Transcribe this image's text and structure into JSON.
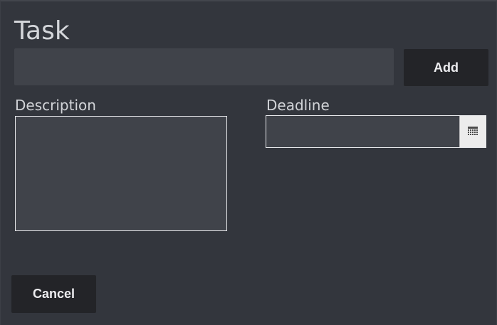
{
  "form": {
    "title": "Task",
    "task_input": {
      "value": "",
      "placeholder": ""
    },
    "add_label": "Add",
    "description_label": "Description",
    "description_value": "",
    "deadline_label": "Deadline",
    "deadline_value": "",
    "calendar_icon": "calendar-icon",
    "cancel_label": "Cancel"
  },
  "colors": {
    "background": "#33363d",
    "input_fill": "#40434a",
    "button_fill": "#232428",
    "text": "#d4d6da"
  }
}
